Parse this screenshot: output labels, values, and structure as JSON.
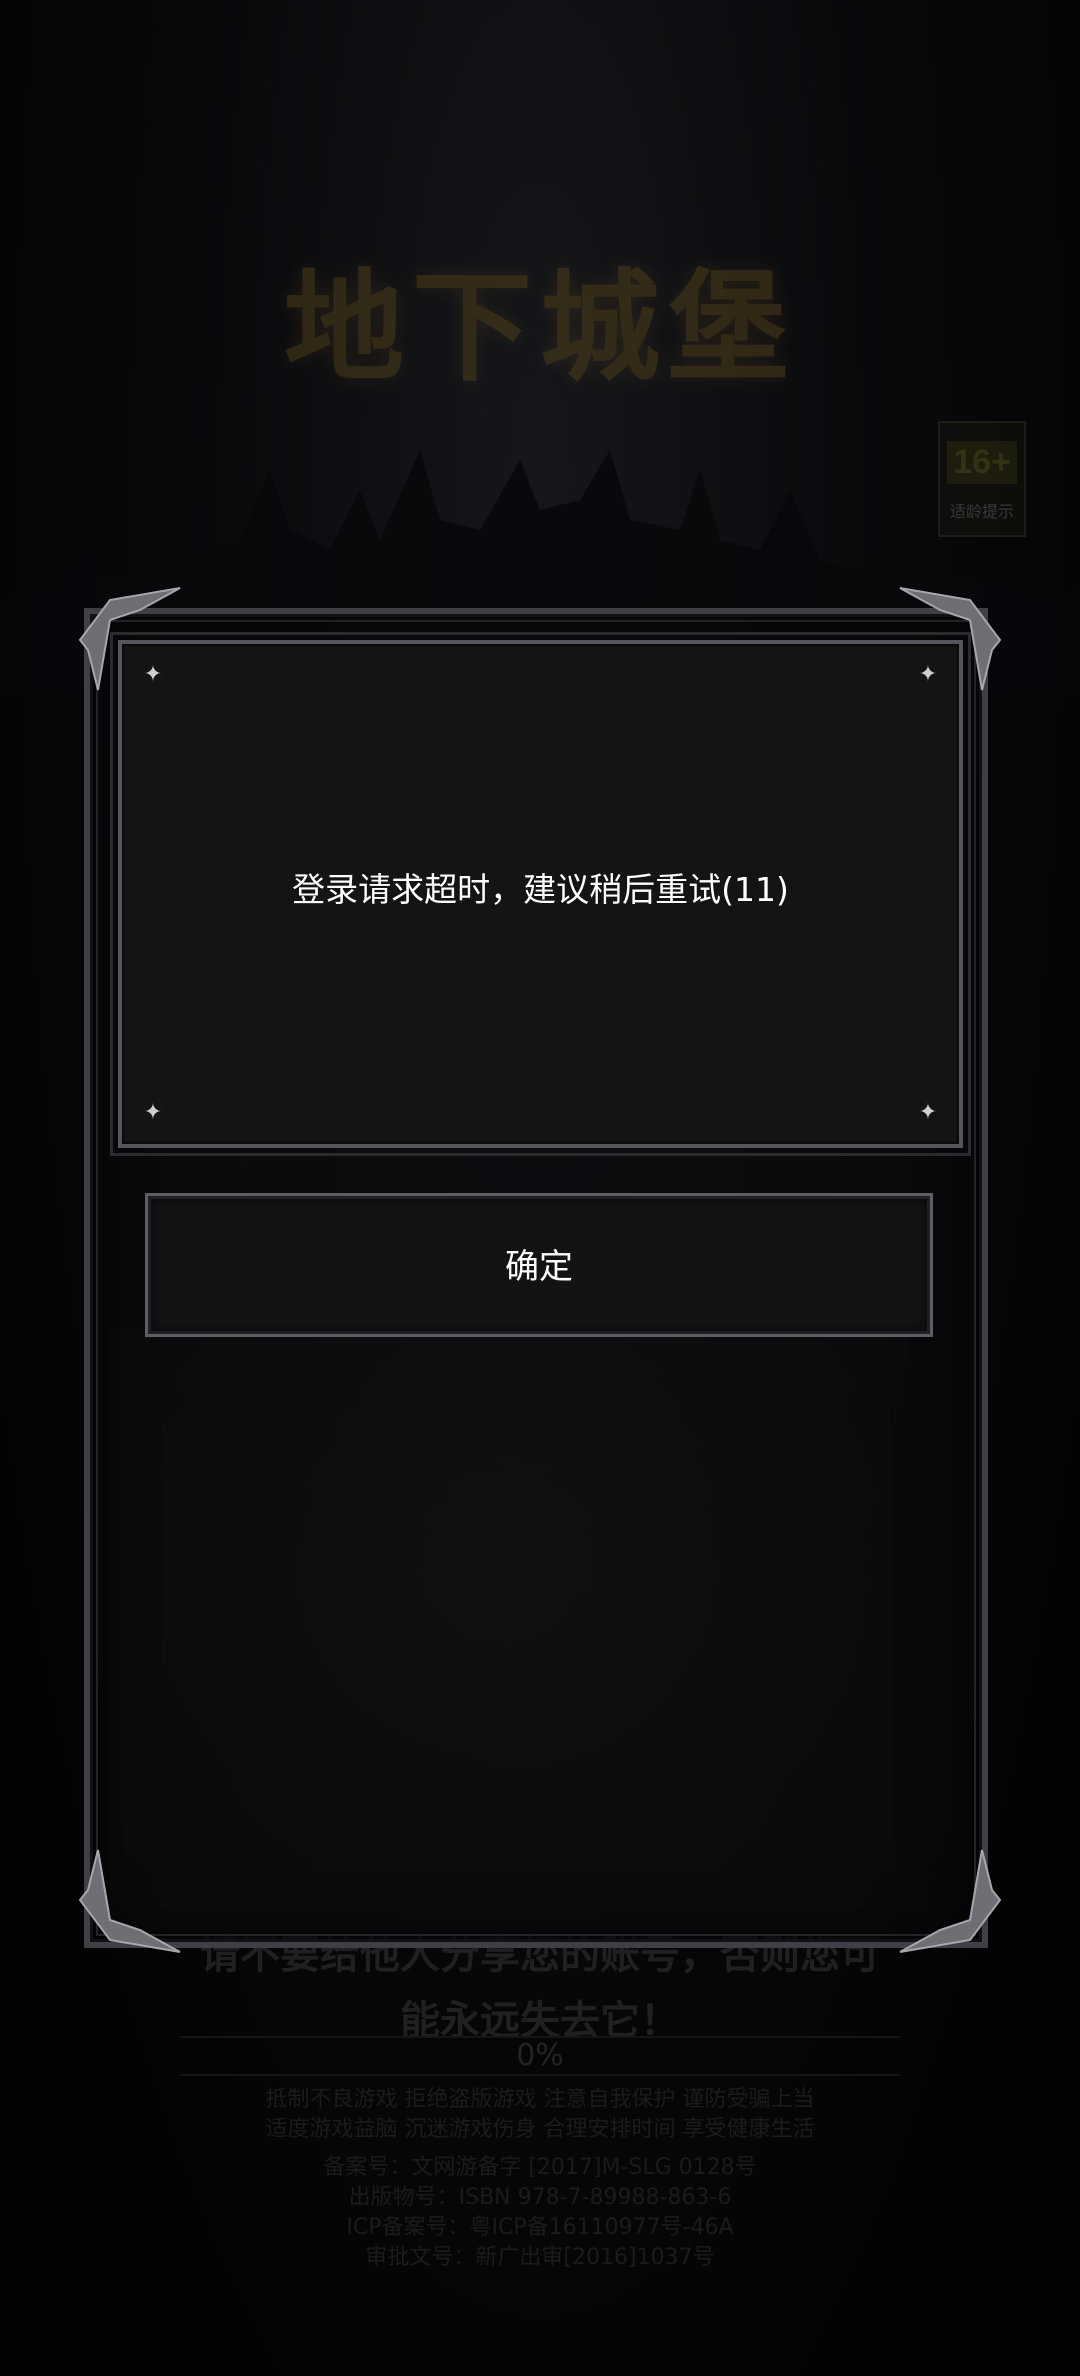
{
  "game": {
    "logo_text": "地下城堡",
    "age_rating": "16+",
    "age_label": "适龄提示"
  },
  "dialog": {
    "message": "登录请求超时，建议稍后重试(11)",
    "confirm_label": "确定"
  },
  "background": {
    "warning_line1": "请不要给他人分享您的账号，否则您可",
    "warning_line2": "能永远失去它！",
    "progress_text": "0%",
    "health_notice_1": "抵制不良游戏  拒绝盗版游戏  注意自我保护  谨防受骗上当",
    "health_notice_2": "适度游戏益脑  沉迷游戏伤身  合理安排时间  享受健康生活",
    "record_no": "备案号：文网游备字 [2017]M-SLG 0128号",
    "publication_no": "出版物号：ISBN 978-7-89988-863-6",
    "icp_no": "ICP备案号：粤ICP备16110977号-46A",
    "approval_no": "审批文号：新广出审[2016]1037号"
  }
}
